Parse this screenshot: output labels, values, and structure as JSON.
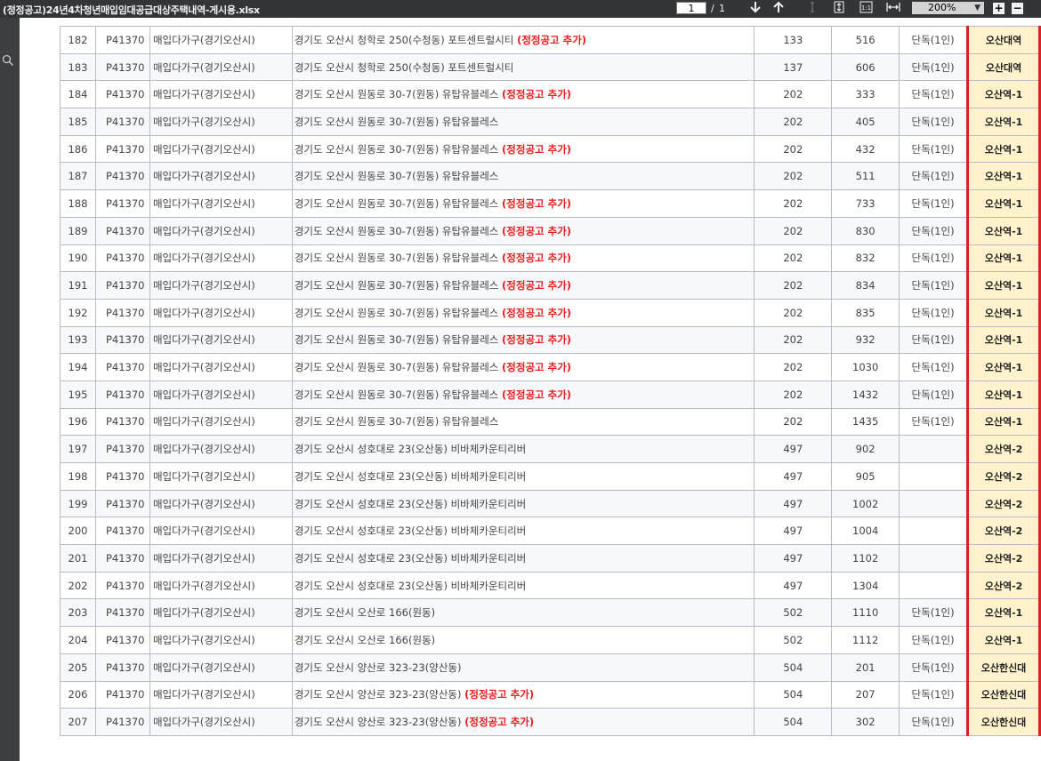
{
  "toolbar": {
    "filename": "(정정공고)24년4차청년매입임대공급대상주택내역-게시용.xlsx",
    "current_page": "1",
    "separator": "/",
    "total_pages": "1",
    "zoom": "200%",
    "icons": [
      "down-arrow-icon",
      "up-arrow-icon",
      "text-cursor-icon",
      "fit-height-icon",
      "actual-size-icon",
      "fit-width-icon",
      "zoom-dropdown-icon",
      "zoom-in-icon",
      "zoom-out-icon",
      "search-icon"
    ]
  },
  "table": {
    "rows": [
      {
        "no": "182",
        "code": "P41370",
        "type": "매입다가구(경기오산시)",
        "addr": "경기도 오산시 청학로 250(수청동) 포트센트럴시티",
        "note": "(정정공고 추가)",
        "bld": "133",
        "unit": "516",
        "house": "단독(1인)",
        "area": "오산대역"
      },
      {
        "no": "183",
        "code": "P41370",
        "type": "매입다가구(경기오산시)",
        "addr": "경기도 오산시 청학로 250(수청동) 포트센트럴시티",
        "note": "",
        "bld": "137",
        "unit": "606",
        "house": "단독(1인)",
        "area": "오산대역"
      },
      {
        "no": "184",
        "code": "P41370",
        "type": "매입다가구(경기오산시)",
        "addr": "경기도 오산시 원동로 30-7(원동) 유탑유블레스",
        "note": "(정정공고 추가)",
        "bld": "202",
        "unit": "333",
        "house": "단독(1인)",
        "area": "오산역-1"
      },
      {
        "no": "185",
        "code": "P41370",
        "type": "매입다가구(경기오산시)",
        "addr": "경기도 오산시 원동로 30-7(원동) 유탑유블레스",
        "note": "",
        "bld": "202",
        "unit": "405",
        "house": "단독(1인)",
        "area": "오산역-1"
      },
      {
        "no": "186",
        "code": "P41370",
        "type": "매입다가구(경기오산시)",
        "addr": "경기도 오산시 원동로 30-7(원동) 유탑유블레스",
        "note": "(정정공고 추가)",
        "bld": "202",
        "unit": "432",
        "house": "단독(1인)",
        "area": "오산역-1"
      },
      {
        "no": "187",
        "code": "P41370",
        "type": "매입다가구(경기오산시)",
        "addr": "경기도 오산시 원동로 30-7(원동) 유탑유블레스",
        "note": "",
        "bld": "202",
        "unit": "511",
        "house": "단독(1인)",
        "area": "오산역-1"
      },
      {
        "no": "188",
        "code": "P41370",
        "type": "매입다가구(경기오산시)",
        "addr": "경기도 오산시 원동로 30-7(원동) 유탑유블레스",
        "note": "(정정공고 추가)",
        "bld": "202",
        "unit": "733",
        "house": "단독(1인)",
        "area": "오산역-1"
      },
      {
        "no": "189",
        "code": "P41370",
        "type": "매입다가구(경기오산시)",
        "addr": "경기도 오산시 원동로 30-7(원동) 유탑유블레스",
        "note": "(정정공고 추가)",
        "bld": "202",
        "unit": "830",
        "house": "단독(1인)",
        "area": "오산역-1"
      },
      {
        "no": "190",
        "code": "P41370",
        "type": "매입다가구(경기오산시)",
        "addr": "경기도 오산시 원동로 30-7(원동) 유탑유블레스",
        "note": "(정정공고 추가)",
        "bld": "202",
        "unit": "832",
        "house": "단독(1인)",
        "area": "오산역-1"
      },
      {
        "no": "191",
        "code": "P41370",
        "type": "매입다가구(경기오산시)",
        "addr": "경기도 오산시 원동로 30-7(원동) 유탑유블레스",
        "note": "(정정공고 추가)",
        "bld": "202",
        "unit": "834",
        "house": "단독(1인)",
        "area": "오산역-1"
      },
      {
        "no": "192",
        "code": "P41370",
        "type": "매입다가구(경기오산시)",
        "addr": "경기도 오산시 원동로 30-7(원동) 유탑유블레스",
        "note": "(정정공고 추가)",
        "bld": "202",
        "unit": "835",
        "house": "단독(1인)",
        "area": "오산역-1"
      },
      {
        "no": "193",
        "code": "P41370",
        "type": "매입다가구(경기오산시)",
        "addr": "경기도 오산시 원동로 30-7(원동) 유탑유블레스",
        "note": "(정정공고 추가)",
        "bld": "202",
        "unit": "932",
        "house": "단독(1인)",
        "area": "오산역-1"
      },
      {
        "no": "194",
        "code": "P41370",
        "type": "매입다가구(경기오산시)",
        "addr": "경기도 오산시 원동로 30-7(원동) 유탑유블레스",
        "note": "(정정공고 추가)",
        "bld": "202",
        "unit": "1030",
        "house": "단독(1인)",
        "area": "오산역-1"
      },
      {
        "no": "195",
        "code": "P41370",
        "type": "매입다가구(경기오산시)",
        "addr": "경기도 오산시 원동로 30-7(원동) 유탑유블레스",
        "note": "(정정공고 추가)",
        "bld": "202",
        "unit": "1432",
        "house": "단독(1인)",
        "area": "오산역-1"
      },
      {
        "no": "196",
        "code": "P41370",
        "type": "매입다가구(경기오산시)",
        "addr": "경기도 오산시 원동로 30-7(원동) 유탑유블레스",
        "note": "",
        "bld": "202",
        "unit": "1435",
        "house": "단독(1인)",
        "area": "오산역-1"
      },
      {
        "no": "197",
        "code": "P41370",
        "type": "매입다가구(경기오산시)",
        "addr": "경기도 오산시 성호대로 23(오산동) 비바체카운티리버",
        "note": "",
        "bld": "497",
        "unit": "902",
        "house": "",
        "area": "오산역-2"
      },
      {
        "no": "198",
        "code": "P41370",
        "type": "매입다가구(경기오산시)",
        "addr": "경기도 오산시 성호대로 23(오산동) 비바체카운티리버",
        "note": "",
        "bld": "497",
        "unit": "905",
        "house": "",
        "area": "오산역-2"
      },
      {
        "no": "199",
        "code": "P41370",
        "type": "매입다가구(경기오산시)",
        "addr": "경기도 오산시 성호대로 23(오산동) 비바체카운티리버",
        "note": "",
        "bld": "497",
        "unit": "1002",
        "house": "",
        "area": "오산역-2"
      },
      {
        "no": "200",
        "code": "P41370",
        "type": "매입다가구(경기오산시)",
        "addr": "경기도 오산시 성호대로 23(오산동) 비바체카운티리버",
        "note": "",
        "bld": "497",
        "unit": "1004",
        "house": "",
        "area": "오산역-2"
      },
      {
        "no": "201",
        "code": "P41370",
        "type": "매입다가구(경기오산시)",
        "addr": "경기도 오산시 성호대로 23(오산동) 비바체카운티리버",
        "note": "",
        "bld": "497",
        "unit": "1102",
        "house": "",
        "area": "오산역-2"
      },
      {
        "no": "202",
        "code": "P41370",
        "type": "매입다가구(경기오산시)",
        "addr": "경기도 오산시 성호대로 23(오산동) 비바체카운티리버",
        "note": "",
        "bld": "497",
        "unit": "1304",
        "house": "",
        "area": "오산역-2"
      },
      {
        "no": "203",
        "code": "P41370",
        "type": "매입다가구(경기오산시)",
        "addr": "경기도 오산시 오산로 166(원동)",
        "note": "",
        "bld": "502",
        "unit": "1110",
        "house": "단독(1인)",
        "area": "오산역-1"
      },
      {
        "no": "204",
        "code": "P41370",
        "type": "매입다가구(경기오산시)",
        "addr": "경기도 오산시 오산로 166(원동)",
        "note": "",
        "bld": "502",
        "unit": "1112",
        "house": "단독(1인)",
        "area": "오산역-1"
      },
      {
        "no": "205",
        "code": "P41370",
        "type": "매입다가구(경기오산시)",
        "addr": "경기도 오산시 양산로 323-23(양산동)",
        "note": "",
        "bld": "504",
        "unit": "201",
        "house": "단독(1인)",
        "area": "오산한신대"
      },
      {
        "no": "206",
        "code": "P41370",
        "type": "매입다가구(경기오산시)",
        "addr": "경기도 오산시 양산로 323-23(양산동)",
        "note": "(정정공고 추가)",
        "bld": "504",
        "unit": "207",
        "house": "단독(1인)",
        "area": "오산한신대"
      },
      {
        "no": "207",
        "code": "P41370",
        "type": "매입다가구(경기오산시)",
        "addr": "경기도 오산시 양산로 323-23(양산동)",
        "note": "(정정공고 추가)",
        "bld": "504",
        "unit": "302",
        "house": "단독(1인)",
        "area": "오산한신대"
      }
    ]
  }
}
